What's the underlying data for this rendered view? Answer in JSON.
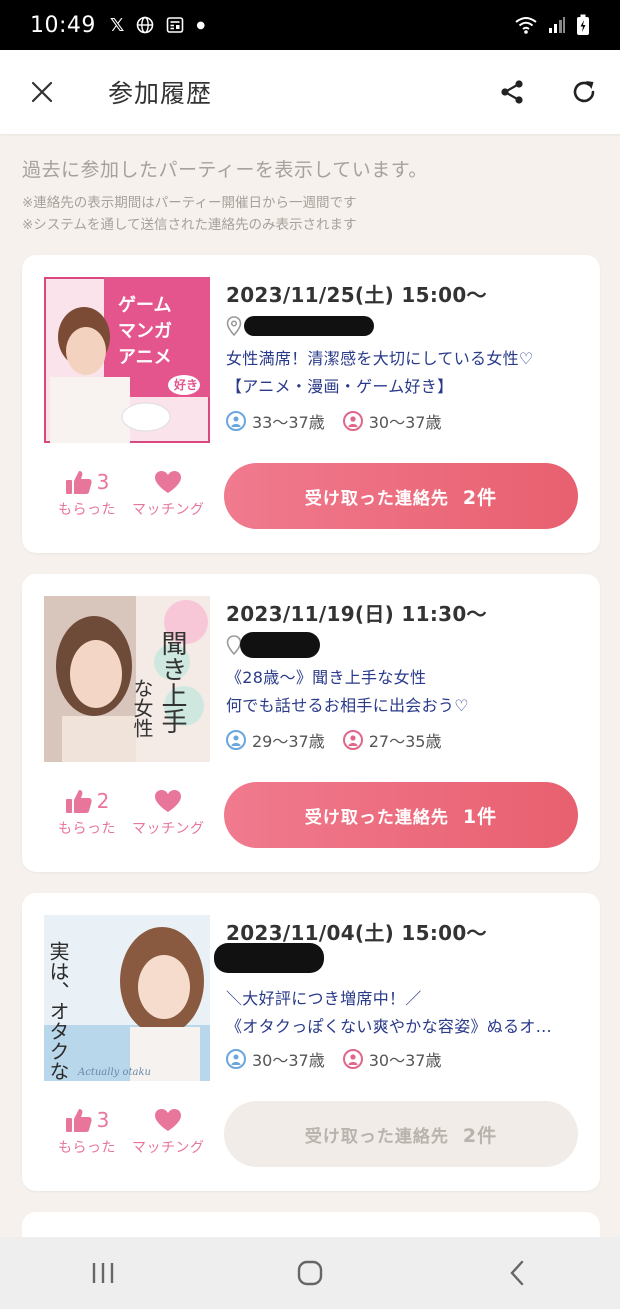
{
  "status_bar": {
    "time": "10:49"
  },
  "header": {
    "title": "参加履歴"
  },
  "intro": {
    "main": "過去に参加したパーティーを表示しています。",
    "notes": [
      "※連絡先の表示期間はパーティー開催日から一週間です",
      "※システムを通して送信された連絡先のみ表示されます"
    ]
  },
  "labels": {
    "likes_label": "もらった",
    "matching_label": "マッチング"
  },
  "cards": [
    {
      "date": "2023/11/25(土) 15:00〜",
      "title_line1": "女性満席！清潔感を大切にしている女性♡",
      "title_line2": "【アニメ・漫画・ゲーム好き】",
      "male_age": "33〜37歳",
      "female_age": "30〜37歳",
      "likes": "3",
      "contact_label": "受け取った連絡先",
      "contact_count": "2件",
      "contact_active": true,
      "thumb": {
        "lines": [
          "ゲーム",
          "マンガ",
          "アニメ"
        ],
        "badge": "好き"
      }
    },
    {
      "date": "2023/11/19(日) 11:30〜",
      "title_line1": "《28歳〜》聞き上手な女性",
      "title_line2": "何でも話せるお相手に出会おう♡",
      "male_age": "29〜37歳",
      "female_age": "27〜35歳",
      "likes": "2",
      "contact_label": "受け取った連絡先",
      "contact_count": "1件",
      "contact_active": true,
      "thumb": {
        "text_a": "聞き上手",
        "text_b": "な女性"
      }
    },
    {
      "date": "2023/11/04(土) 15:00〜",
      "title_line1": "＼大好評につき増席中！／",
      "title_line2": "《オタクっぽくない爽やかな容姿》ぬるオ...",
      "male_age": "30〜37歳",
      "female_age": "30〜37歳",
      "likes": "3",
      "contact_label": "受け取った連絡先",
      "contact_count": "2件",
      "contact_active": false,
      "thumb": {
        "text": "実は、オタクなんです♪",
        "caption": "Actually otaku"
      }
    }
  ],
  "colors": {
    "accent": "#e8769a",
    "button": "#ee6e80",
    "title_text": "#2a3a8a"
  }
}
